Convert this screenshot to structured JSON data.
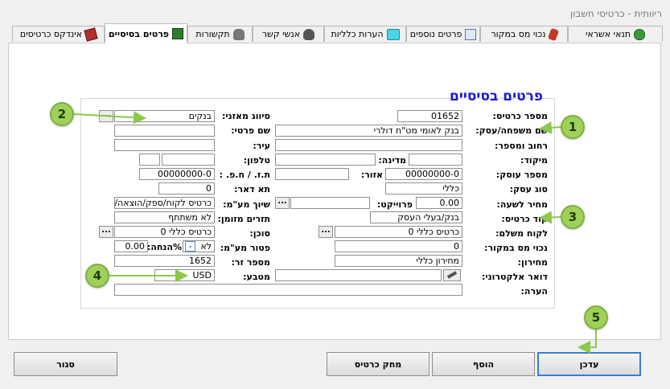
{
  "window": {
    "title": "ריוותית - כרטיסי חשבון"
  },
  "tabs": [
    {
      "label": "תנאי אשראי",
      "icon": "money-bag-icon"
    },
    {
      "label": "נכוי מס במקור",
      "icon": "hand-icon"
    },
    {
      "label": "פרטים נוספים",
      "icon": "document-icon"
    },
    {
      "label": "הערות כלליות",
      "icon": "edit-icon"
    },
    {
      "label": "אנשי קשר",
      "icon": "person-icon"
    },
    {
      "label": "תקשורות",
      "icon": "phone-icon"
    },
    {
      "label": "פרטים בסיסיים",
      "icon": "notebook-icon"
    },
    {
      "label": "אינדקס כרטיסים",
      "icon": "cards-icon"
    }
  ],
  "section_title": "פרטים בסיסיים",
  "labels": {
    "card_number": "מספר כרטיס:",
    "last_name": "שם משפחה/עסק:",
    "street": "רחוב ומספר:",
    "zip": "מיקוד:",
    "country": "מדינה:",
    "dealer_number": "מספר עוסק:",
    "region": "אזור:",
    "id_number": "ת.ז. / ח.פ. :",
    "business_type": "סוג עסק:",
    "project": "פרוייקט:",
    "price_type": "מחיר לשעה:",
    "card_code": "קוד כרטיס:",
    "payer_customer": "לקוח משלם:",
    "withholding_tax": "נכוי מס במקור:",
    "price_list": "מחירון:",
    "email": "דואר אלקטרוני:",
    "remark": "הערה:",
    "balance_sort": "סיווג מאזני:",
    "first_name": "שם פרטי:",
    "city": "עיר:",
    "phone": "טלפון:",
    "po_box": "תא דאר:",
    "vat_assignment": "שיוך מע\"מ:",
    "cash_turnover": "תזרים מזומן:",
    "agent": "סוכן:",
    "vat_exempt": "פטור מע\"מ:",
    "discount": "%הנחה:",
    "foreign_number": "מספר זר:",
    "currency": "מטבע:"
  },
  "values": {
    "card_number": "01652",
    "last_name": "בנק לאומי מט\"ח דולרי",
    "street": "",
    "zip": "",
    "country": "",
    "dealer_number": "00000000-0",
    "region": "",
    "id_number": "00000000-0",
    "business_type": "כללי",
    "project": "",
    "hourly_price": "0.00",
    "card_code": "בנק/בעלי העסק",
    "payer_customer": "כרטיס כללי 0",
    "withholding_tax": "0",
    "price_list": "מחירון כללי",
    "email": "",
    "remark": "",
    "balance_sort": "בנקים",
    "first_name": "",
    "city": "",
    "phone_a": "",
    "phone_b": "",
    "po_box": "0",
    "vat_assignment": "כרטיס לקוח/ספק/הוצאה/ה",
    "cash_turnover": "לא משתתף",
    "agent": "כרטיס כללי 0",
    "vat_exempt": "לא",
    "discount": "0.00",
    "foreign_number": "1652",
    "currency": "USD"
  },
  "buttons": {
    "update": "עדכן",
    "add": "הוסף",
    "delete": "מחק כרטיס",
    "close": "סגור",
    "dots": "..."
  },
  "callouts": [
    "1",
    "2",
    "3",
    "4",
    "5"
  ],
  "colors": {
    "section_title": "#1a1acc",
    "callout": "#9fd05a"
  }
}
